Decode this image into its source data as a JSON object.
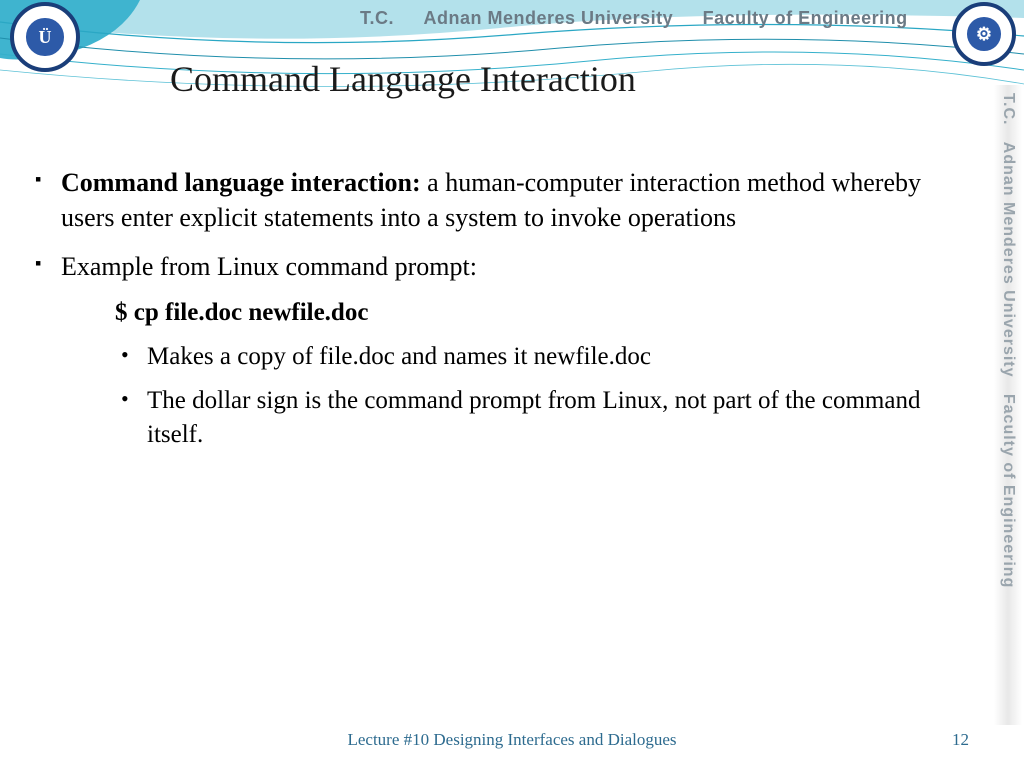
{
  "header": {
    "prefix": "T.C.",
    "university": "Adnan Menderes University",
    "faculty": "Faculty of Engineering"
  },
  "slide": {
    "title": "Command Language Interaction"
  },
  "content": {
    "bullet1_bold": "Command language interaction:",
    "bullet1_rest": " a human-computer interaction method whereby users enter explicit statements into a system to invoke operations",
    "bullet2": "Example from Linux command prompt:",
    "command": "$ cp file.doc newfile.doc",
    "sub1": "Makes a copy of file.doc and names it newfile.doc",
    "sub2": "The dollar sign is the command prompt from Linux, not part of the command itself."
  },
  "sidebar": {
    "prefix": "T.C.",
    "university": "Adnan Menderes University",
    "faculty": "Faculty of Engineering"
  },
  "footer": {
    "text": "Lecture #10 Designing Interfaces and Dialogues",
    "page": "12"
  }
}
